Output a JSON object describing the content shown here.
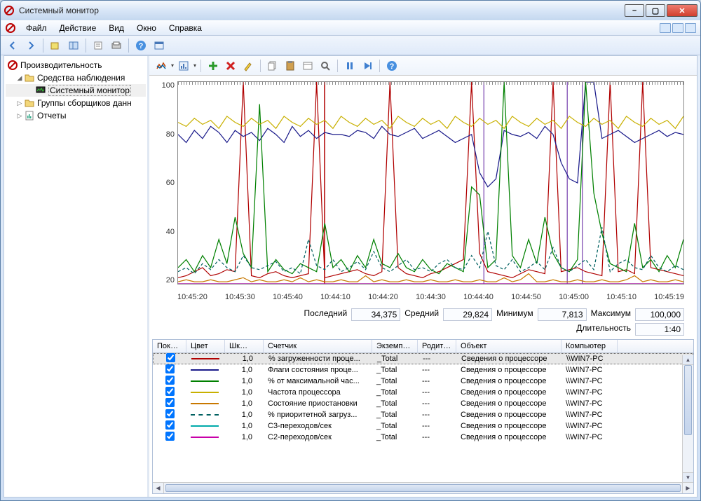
{
  "window": {
    "title": "Системный монитор"
  },
  "menu": {
    "items": [
      "Файл",
      "Действие",
      "Вид",
      "Окно",
      "Справка"
    ]
  },
  "tree": {
    "root": "Производительность",
    "items": [
      {
        "label": "Средства наблюдения",
        "level": 2,
        "expanded": true,
        "icon": "folder"
      },
      {
        "label": "Системный монитор",
        "level": 3,
        "selected": true,
        "icon": "monitor"
      },
      {
        "label": "Группы сборщиков данн",
        "level": 2,
        "expanded": false,
        "icon": "folder",
        "expander": "▷"
      },
      {
        "label": "Отчеты",
        "level": 2,
        "expanded": false,
        "icon": "report",
        "expander": "▷"
      }
    ]
  },
  "chart_data": {
    "type": "line",
    "ylim": [
      0,
      100
    ],
    "yticks": [
      100,
      80,
      60,
      40,
      20
    ],
    "xticks": [
      "10:45:20",
      "10:45:30",
      "10:45:40",
      "10:44:10",
      "10:44:20",
      "10:44:30",
      "10:44:40",
      "10:44:50",
      "10:45:00",
      "10:45:10",
      "10:45:19"
    ],
    "series": [
      {
        "name": "% загруженности процессора",
        "color": "#b00000",
        "values": [
          3,
          4,
          6,
          8,
          4,
          5,
          7,
          6,
          100,
          4,
          3,
          5,
          6,
          4,
          3,
          4,
          5,
          100,
          3,
          4,
          5,
          6,
          7,
          5,
          4,
          6,
          100,
          8,
          5,
          4,
          3,
          5,
          6,
          8,
          10,
          12,
          100,
          15,
          6,
          5,
          4,
          3,
          5,
          7,
          6,
          5,
          100,
          6,
          7,
          8,
          6,
          5,
          4,
          100,
          6,
          7,
          5,
          100,
          8,
          7,
          6,
          5,
          4
        ]
      },
      {
        "name": "Флаги состояния процессора",
        "color": "#1a1a8a",
        "values": [
          74,
          70,
          76,
          72,
          78,
          75,
          70,
          76,
          73,
          75,
          71,
          77,
          74,
          70,
          78,
          73,
          76,
          72,
          75,
          74,
          74,
          73,
          76,
          75,
          72,
          78,
          74,
          73,
          75,
          77,
          72,
          74,
          76,
          73,
          70,
          72,
          74,
          55,
          48,
          52,
          76,
          74,
          73,
          75,
          72,
          78,
          74,
          60,
          52,
          50,
          100,
          100,
          72,
          74,
          76,
          73,
          70,
          72,
          74,
          76,
          73,
          75,
          74
        ]
      },
      {
        "name": "% от максимальной частоты",
        "color": "#008000",
        "values": [
          8,
          12,
          6,
          14,
          8,
          22,
          10,
          33,
          15,
          8,
          89,
          6,
          12,
          7,
          5,
          10,
          8,
          6,
          30,
          8,
          12,
          6,
          14,
          8,
          22,
          10,
          8,
          15,
          8,
          6,
          12,
          7,
          5,
          10,
          8,
          6,
          48,
          44,
          8,
          12,
          100,
          14,
          8,
          22,
          10,
          33,
          15,
          8,
          6,
          12,
          100,
          45,
          25,
          10,
          8,
          6,
          30,
          8,
          12,
          6,
          14,
          8,
          22
        ]
      },
      {
        "name": "Частота процессора",
        "color": "#c8b000",
        "values": [
          80,
          78,
          82,
          79,
          81,
          77,
          83,
          80,
          78,
          82,
          79,
          81,
          77,
          83,
          80,
          78,
          82,
          79,
          81,
          77,
          83,
          80,
          78,
          82,
          79,
          81,
          77,
          83,
          80,
          78,
          82,
          79,
          81,
          77,
          83,
          80,
          78,
          82,
          79,
          81,
          77,
          83,
          80,
          78,
          82,
          79,
          81,
          77,
          83,
          80,
          78,
          82,
          79,
          81,
          77,
          83,
          80,
          78,
          82,
          79,
          81,
          77,
          83
        ]
      },
      {
        "name": "Состояние приостановки",
        "color": "#c87800",
        "values": [
          1,
          2,
          1,
          1,
          2,
          1,
          1,
          2,
          3,
          1,
          2,
          1,
          1,
          2,
          1,
          3,
          1,
          2,
          1,
          1,
          2,
          1,
          1,
          4,
          1,
          2,
          1,
          1,
          2,
          1,
          1,
          2,
          1,
          1,
          2,
          1,
          1,
          2,
          1,
          1,
          3,
          1,
          2,
          5,
          1,
          1,
          2,
          1,
          1,
          2,
          1,
          1,
          2,
          1,
          1,
          2,
          4,
          1,
          2,
          1,
          1,
          2,
          1
        ]
      },
      {
        "name": "% приоритетной загрузки",
        "color": "#006060",
        "dashed": true,
        "values": [
          6,
          8,
          5,
          10,
          7,
          12,
          8,
          6,
          14,
          8,
          7,
          9,
          11,
          6,
          8,
          5,
          22,
          9,
          7,
          12,
          6,
          8,
          11,
          7,
          16,
          8,
          6,
          9,
          12,
          7,
          8,
          6,
          10,
          12,
          8,
          7,
          14,
          8,
          26,
          9,
          7,
          12,
          6,
          8,
          11,
          7,
          18,
          8,
          6,
          9,
          12,
          7,
          28,
          6,
          10,
          12,
          8,
          7,
          14,
          8,
          6,
          9,
          7
        ]
      },
      {
        "name": "C3-переходов/сек",
        "color": "#00aaaa",
        "values": [
          0,
          0,
          0,
          0,
          0,
          0,
          0,
          0,
          0,
          0,
          0,
          0,
          0,
          0,
          0,
          0,
          0,
          0,
          0,
          0,
          0,
          0,
          0,
          0,
          0,
          0,
          0,
          0,
          0,
          0,
          0,
          0,
          0,
          0,
          0,
          0,
          0,
          0,
          0,
          0,
          0,
          0,
          0,
          0,
          0,
          0,
          0,
          0,
          0,
          0,
          0,
          0,
          0,
          0,
          0,
          0,
          0,
          0,
          0,
          0,
          0,
          0,
          0
        ]
      },
      {
        "name": "C2-переходов/сек",
        "color": "#c800a8",
        "values": [
          0,
          0,
          0,
          0,
          0,
          0,
          0,
          0,
          0,
          0,
          0,
          0,
          0,
          0,
          0,
          0,
          0,
          0,
          0,
          0,
          0,
          0,
          0,
          0,
          0,
          0,
          0,
          0,
          0,
          0,
          0,
          0,
          0,
          0,
          0,
          0,
          0,
          0,
          0,
          0,
          0,
          0,
          0,
          0,
          0,
          0,
          0,
          0,
          0,
          0,
          0,
          0,
          0,
          0,
          0,
          0,
          0,
          0,
          0,
          0,
          0,
          0,
          0
        ]
      }
    ]
  },
  "stats": {
    "labels": {
      "last": "Последний",
      "avg": "Средний",
      "min": "Минимум",
      "max": "Максимум",
      "dur": "Длительность"
    },
    "values": {
      "last": "34,375",
      "avg": "29,824",
      "min": "7,813",
      "max": "100,000",
      "dur": "1:40"
    }
  },
  "counters": {
    "headers": {
      "show": "Показа...",
      "color": "Цвет",
      "scale": "Шкала",
      "counter": "Счетчик",
      "instance": "Экземпляр",
      "parent": "Родитель",
      "object": "Объект",
      "computer": "Компьютер"
    },
    "rows": [
      {
        "checked": true,
        "color": "#b00000",
        "scale": "1,0",
        "counter": "% загруженности проце...",
        "instance": "_Total",
        "parent": "---",
        "object": "Сведения о процессоре",
        "computer": "\\\\WIN7-PC",
        "selected": true
      },
      {
        "checked": true,
        "color": "#1a1a8a",
        "scale": "1,0",
        "counter": "Флаги состояния проце...",
        "instance": "_Total",
        "parent": "---",
        "object": "Сведения о процессоре",
        "computer": "\\\\WIN7-PC"
      },
      {
        "checked": true,
        "color": "#008000",
        "scale": "1,0",
        "counter": "% от максимальной час...",
        "instance": "_Total",
        "parent": "---",
        "object": "Сведения о процессоре",
        "computer": "\\\\WIN7-PC"
      },
      {
        "checked": true,
        "color": "#c8b000",
        "scale": "1,0",
        "counter": "Частота процессора",
        "instance": "_Total",
        "parent": "---",
        "object": "Сведения о процессоре",
        "computer": "\\\\WIN7-PC"
      },
      {
        "checked": true,
        "color": "#c87800",
        "scale": "1,0",
        "counter": "Состояние приостановки",
        "instance": "_Total",
        "parent": "---",
        "object": "Сведения о процессоре",
        "computer": "\\\\WIN7-PC"
      },
      {
        "checked": true,
        "color": "#006060",
        "scale": "1,0",
        "counter": "% приоритетной загруз...",
        "instance": "_Total",
        "parent": "---",
        "object": "Сведения о процессоре",
        "computer": "\\\\WIN7-PC",
        "dashed": true
      },
      {
        "checked": true,
        "color": "#00aaaa",
        "scale": "1,0",
        "counter": "C3-переходов/сек",
        "instance": "_Total",
        "parent": "---",
        "object": "Сведения о процессоре",
        "computer": "\\\\WIN7-PC"
      },
      {
        "checked": true,
        "color": "#c800a8",
        "scale": "1,0",
        "counter": "C2-переходов/сек",
        "instance": "_Total",
        "parent": "---",
        "object": "Сведения о процессоре",
        "computer": "\\\\WIN7-PC"
      }
    ]
  }
}
